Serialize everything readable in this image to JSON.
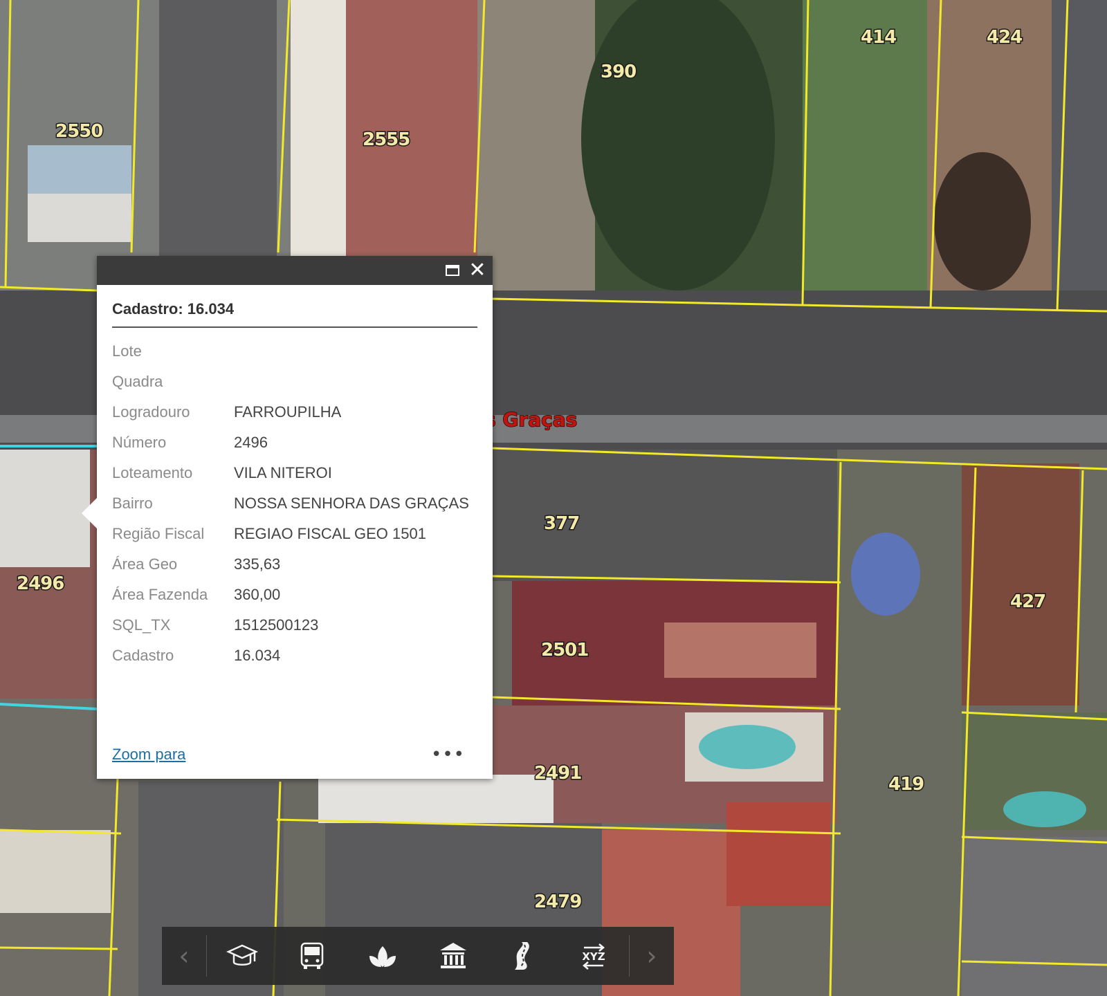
{
  "map": {
    "lot_labels": [
      {
        "text": "2550"
      },
      {
        "text": "2555"
      },
      {
        "text": "390"
      },
      {
        "text": "414"
      },
      {
        "text": "424"
      },
      {
        "text": "2496"
      },
      {
        "text": "377"
      },
      {
        "text": "427"
      },
      {
        "text": "2501"
      },
      {
        "text": "2491"
      },
      {
        "text": "419"
      },
      {
        "text": "2479"
      }
    ],
    "street_label": "s Graças",
    "parcel_line_color": "#f2e92a",
    "selected_parcel_color": "#3fd6e0"
  },
  "popup": {
    "title": "Cadastro: 16.034",
    "attributes": [
      {
        "key": "Lote",
        "value": ""
      },
      {
        "key": "Quadra",
        "value": ""
      },
      {
        "key": "Logradouro",
        "value": "FARROUPILHA"
      },
      {
        "key": "Número",
        "value": "2496"
      },
      {
        "key": "Loteamento",
        "value": "VILA NITEROI"
      },
      {
        "key": "Bairro",
        "value": "NOSSA SENHORA DAS GRAÇAS"
      },
      {
        "key": "Região Fiscal",
        "value": "REGIAO FISCAL GEO 1501"
      },
      {
        "key": "Área Geo",
        "value": "335,63"
      },
      {
        "key": "Área Fazenda",
        "value": "360,00"
      },
      {
        "key": "SQL_TX",
        "value": "1512500123"
      },
      {
        "key": "Cadastro",
        "value": "16.034"
      }
    ],
    "zoom_label": "Zoom para",
    "more_label": "•••"
  },
  "toolbar": {
    "prev_label": "‹",
    "next_label": "›",
    "tools": [
      {
        "name": "education-icon"
      },
      {
        "name": "bus-icon"
      },
      {
        "name": "plant-icon"
      },
      {
        "name": "building-icon"
      },
      {
        "name": "road-icon"
      },
      {
        "name": "xyz-icon",
        "text": "XYZ"
      }
    ]
  }
}
